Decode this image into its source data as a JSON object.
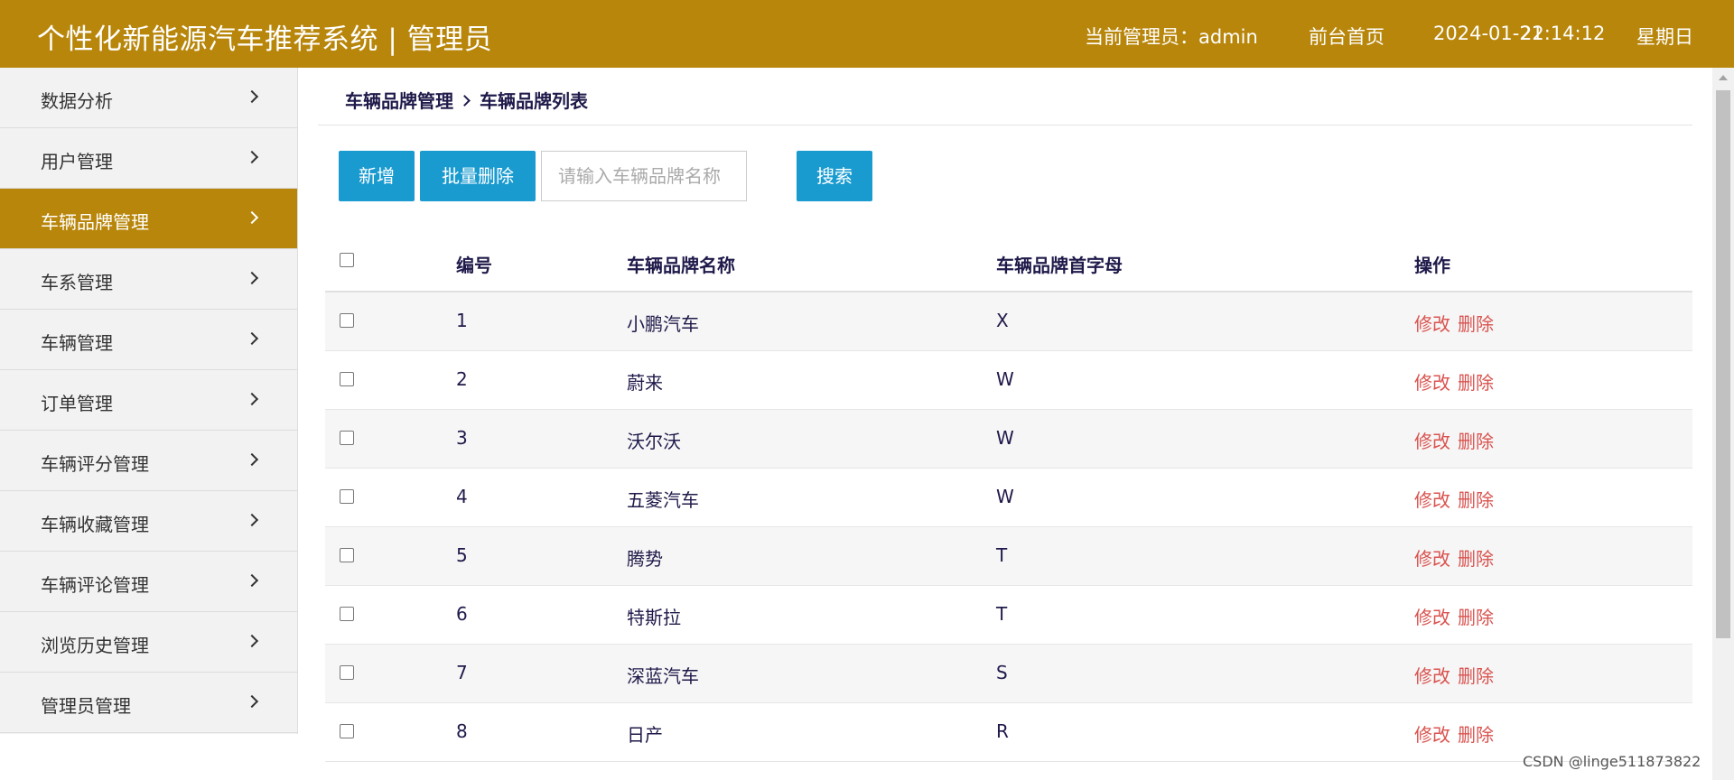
{
  "header": {
    "title": "个性化新能源汽车推荐系统 | 管理员",
    "admin_label": "当前管理员：admin",
    "home_link": "前台首页",
    "date": "2024-01-21",
    "time": "22:14:12",
    "weekday": "星期日"
  },
  "sidebar": {
    "items": [
      {
        "label": "数据分析"
      },
      {
        "label": "用户管理"
      },
      {
        "label": "车辆品牌管理",
        "active": true
      },
      {
        "label": "车系管理"
      },
      {
        "label": "车辆管理"
      },
      {
        "label": "订单管理"
      },
      {
        "label": "车辆评分管理"
      },
      {
        "label": "车辆收藏管理"
      },
      {
        "label": "车辆评论管理"
      },
      {
        "label": "浏览历史管理"
      },
      {
        "label": "管理员管理"
      }
    ]
  },
  "breadcrumb": {
    "parent": "车辆品牌管理",
    "current": "车辆品牌列表"
  },
  "toolbar": {
    "add_label": "新增",
    "batch_delete_label": "批量删除",
    "search_placeholder": "请输入车辆品牌名称",
    "search_value": "",
    "search_label": "搜索"
  },
  "table": {
    "columns": [
      "编号",
      "车辆品牌名称",
      "车辆品牌首字母",
      "操作"
    ],
    "rows": [
      {
        "id": "1",
        "name": "小鹏汽车",
        "letter": "X"
      },
      {
        "id": "2",
        "name": "蔚来",
        "letter": "W"
      },
      {
        "id": "3",
        "name": "沃尔沃",
        "letter": "W"
      },
      {
        "id": "4",
        "name": "五菱汽车",
        "letter": "W"
      },
      {
        "id": "5",
        "name": "腾势",
        "letter": "T"
      },
      {
        "id": "6",
        "name": "特斯拉",
        "letter": "T"
      },
      {
        "id": "7",
        "name": "深蓝汽车",
        "letter": "S"
      },
      {
        "id": "8",
        "name": "日产",
        "letter": "R"
      }
    ],
    "edit_label": "修改",
    "delete_label": "删除"
  },
  "watermark": "CSDN @linge511873822",
  "colors": {
    "header_bg": "#b8860b",
    "active_bg": "#b8860b",
    "button_bg": "#1a9bd0",
    "link_red": "#d9534f",
    "text_dark": "#1f1a4a"
  }
}
